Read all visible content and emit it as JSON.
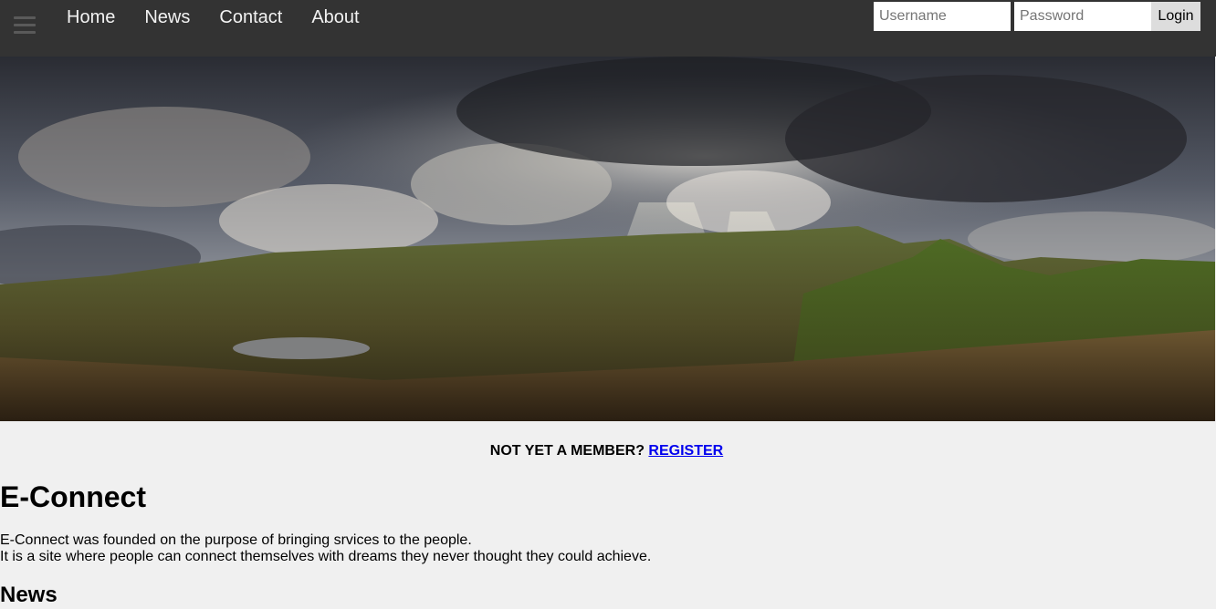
{
  "nav": {
    "menu_icon": "hamburger-menu-icon",
    "links": [
      "Home",
      "News",
      "Contact",
      "About"
    ]
  },
  "login": {
    "username_placeholder": "Username",
    "password_placeholder": "Password",
    "button_label": "Login"
  },
  "hero": {
    "image": "mountain-landscape-photo"
  },
  "register": {
    "prompt": "NOT YET A MEMBER?",
    "link_label": "REGISTER"
  },
  "main": {
    "title": "E-Connect",
    "intro_line1": "E-Connect was founded on the purpose of bringing srvices to the people.",
    "intro_line2": "It is a site where people can connect themselves with dreams they never thought they could achieve.",
    "news_heading": "News"
  },
  "colors": {
    "navbar": "#333333",
    "nav_text": "#f2f2f2",
    "page_bg": "#f0f0f0",
    "link": "#0000ee",
    "login_button": "#dddddd"
  }
}
